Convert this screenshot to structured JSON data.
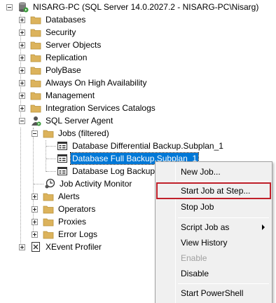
{
  "server": {
    "label": "NISARG-PC (SQL Server 14.0.2027.2 - NISARG-PC\\Nisarg)"
  },
  "nodes": {
    "databases": "Databases",
    "security": "Security",
    "server_objects": "Server Objects",
    "replication": "Replication",
    "polybase": "PolyBase",
    "always_on": "Always On High Availability",
    "management": "Management",
    "integration_services": "Integration Services Catalogs",
    "sql_agent": "SQL Server Agent",
    "jobs": "Jobs (filtered)",
    "job1": "Database Differential Backup.Subplan_1",
    "job2": "Database Full Backup.Subplan_1",
    "job3": "Database Log Backup.S",
    "job_activity_monitor": "Job Activity Monitor",
    "alerts": "Alerts",
    "operators": "Operators",
    "proxies": "Proxies",
    "error_logs": "Error Logs",
    "xevent_profiler": "XEvent Profiler"
  },
  "context_menu": {
    "new_job": "New Job...",
    "start_job_at_step": "Start Job at Step...",
    "stop_job": "Stop Job",
    "script_job_as": "Script Job as",
    "view_history": "View History",
    "enable": "Enable",
    "disable": "Disable",
    "start_powershell": "Start PowerShell"
  },
  "colors": {
    "selection": "#0078d7",
    "highlight_box": "#c0202a",
    "folder": "#dcb35c"
  }
}
